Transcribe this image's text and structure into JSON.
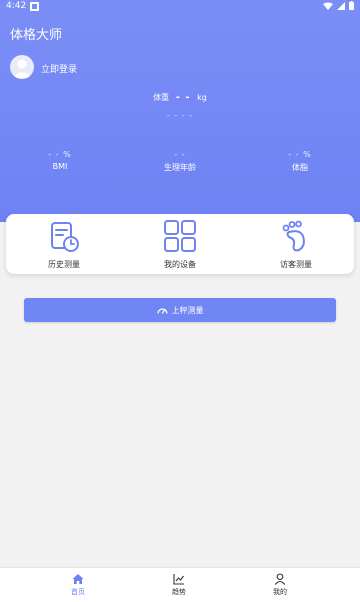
{
  "status_bar": {
    "time": "4:42"
  },
  "header": {
    "title": "体格大师",
    "login_label": "立即登录"
  },
  "weight": {
    "label": "体重",
    "value": "- -",
    "unit": "kg",
    "secondary": "- - - -"
  },
  "metrics": [
    {
      "value": "- - %",
      "label": "BMI"
    },
    {
      "value": "- -",
      "label": "生理年龄"
    },
    {
      "value": "- - %",
      "label": "体脂"
    }
  ],
  "quick_actions": [
    {
      "label": "历史测量",
      "icon": "history-icon"
    },
    {
      "label": "我的设备",
      "icon": "devices-grid-icon"
    },
    {
      "label": "访客测量",
      "icon": "footprint-icon"
    }
  ],
  "measure_button": {
    "label": "上秤测量",
    "icon": "gauge-icon"
  },
  "tabs": [
    {
      "label": "首页",
      "icon": "home-icon",
      "active": true
    },
    {
      "label": "趋势",
      "icon": "trend-chart-icon",
      "active": false
    },
    {
      "label": "我的",
      "icon": "person-icon",
      "active": false
    }
  ],
  "colors": {
    "primary": "#6e82f4",
    "background": "#f2f2f2"
  }
}
